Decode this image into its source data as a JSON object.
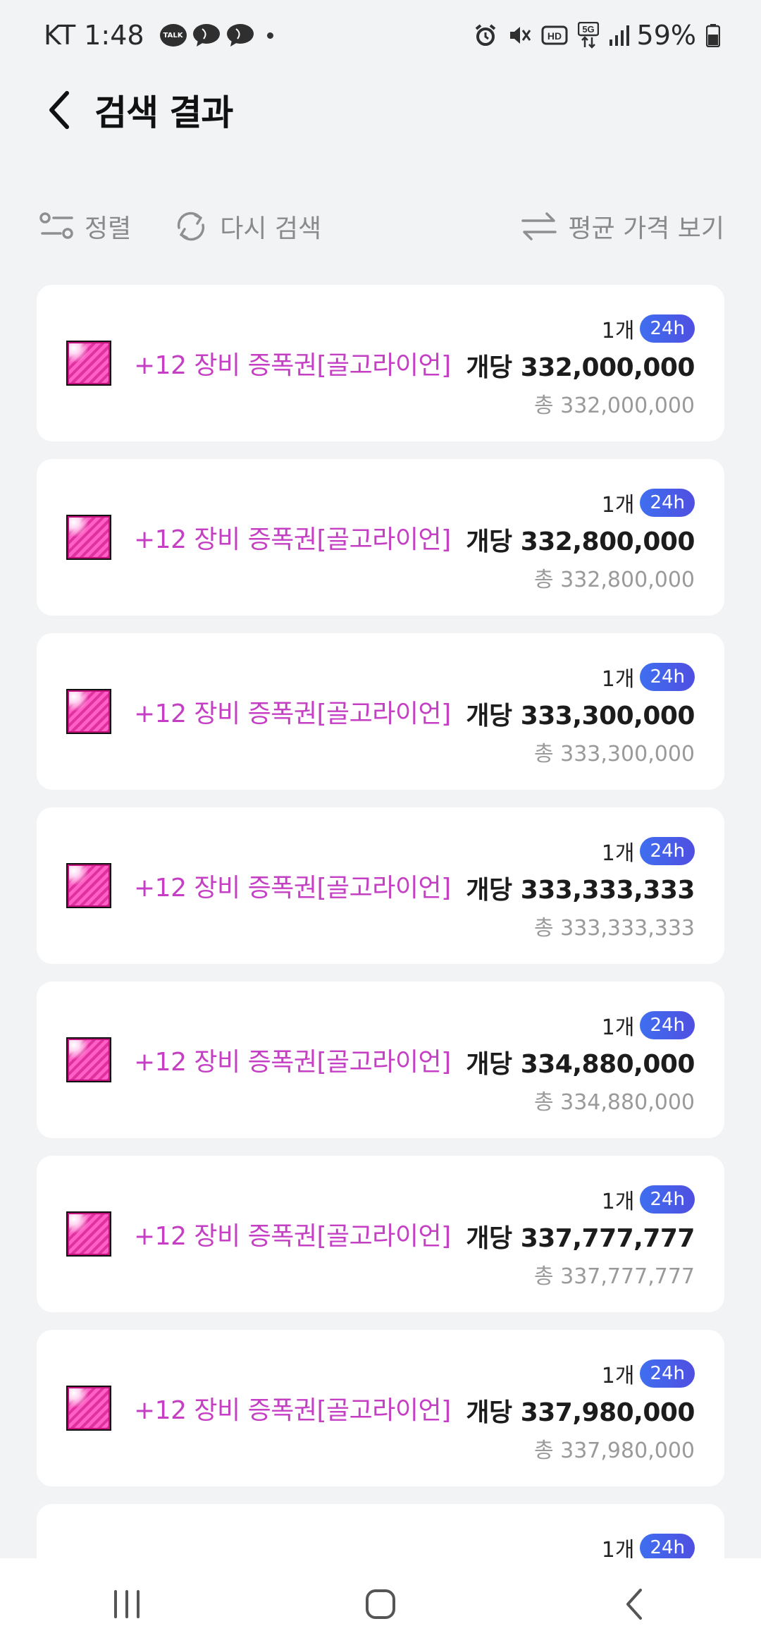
{
  "status_bar": {
    "carrier_time": "KT 1:48",
    "talk_label": "TALK",
    "battery": "59%"
  },
  "header": {
    "title": "검색 결과"
  },
  "toolbar": {
    "sort_label": "정렬",
    "research_label": "다시 검색",
    "avg_label": "평균 가격 보기"
  },
  "colors": {
    "item_name": "#c43fc4",
    "badge": "#4f5fe6",
    "background": "#f2f3f5"
  },
  "results": [
    {
      "name": "+12 장비 증폭권[골고라이언]",
      "qty": "1개",
      "badge": "24h",
      "unit_price": "개당 332,000,000",
      "total_price": "총 332,000,000"
    },
    {
      "name": "+12 장비 증폭권[골고라이언]",
      "qty": "1개",
      "badge": "24h",
      "unit_price": "개당 332,800,000",
      "total_price": "총 332,800,000"
    },
    {
      "name": "+12 장비 증폭권[골고라이언]",
      "qty": "1개",
      "badge": "24h",
      "unit_price": "개당 333,300,000",
      "total_price": "총 333,300,000"
    },
    {
      "name": "+12 장비 증폭권[골고라이언]",
      "qty": "1개",
      "badge": "24h",
      "unit_price": "개당 333,333,333",
      "total_price": "총 333,333,333"
    },
    {
      "name": "+12 장비 증폭권[골고라이언]",
      "qty": "1개",
      "badge": "24h",
      "unit_price": "개당 334,880,000",
      "total_price": "총 334,880,000"
    },
    {
      "name": "+12 장비 증폭권[골고라이언]",
      "qty": "1개",
      "badge": "24h",
      "unit_price": "개당 337,777,777",
      "total_price": "총 337,777,777"
    },
    {
      "name": "+12 장비 증폭권[골고라이언]",
      "qty": "1개",
      "badge": "24h",
      "unit_price": "개당 337,980,000",
      "total_price": "총 337,980,000"
    },
    {
      "name": "",
      "qty": "1개",
      "badge": "24h",
      "unit_price": "",
      "total_price": ""
    }
  ]
}
